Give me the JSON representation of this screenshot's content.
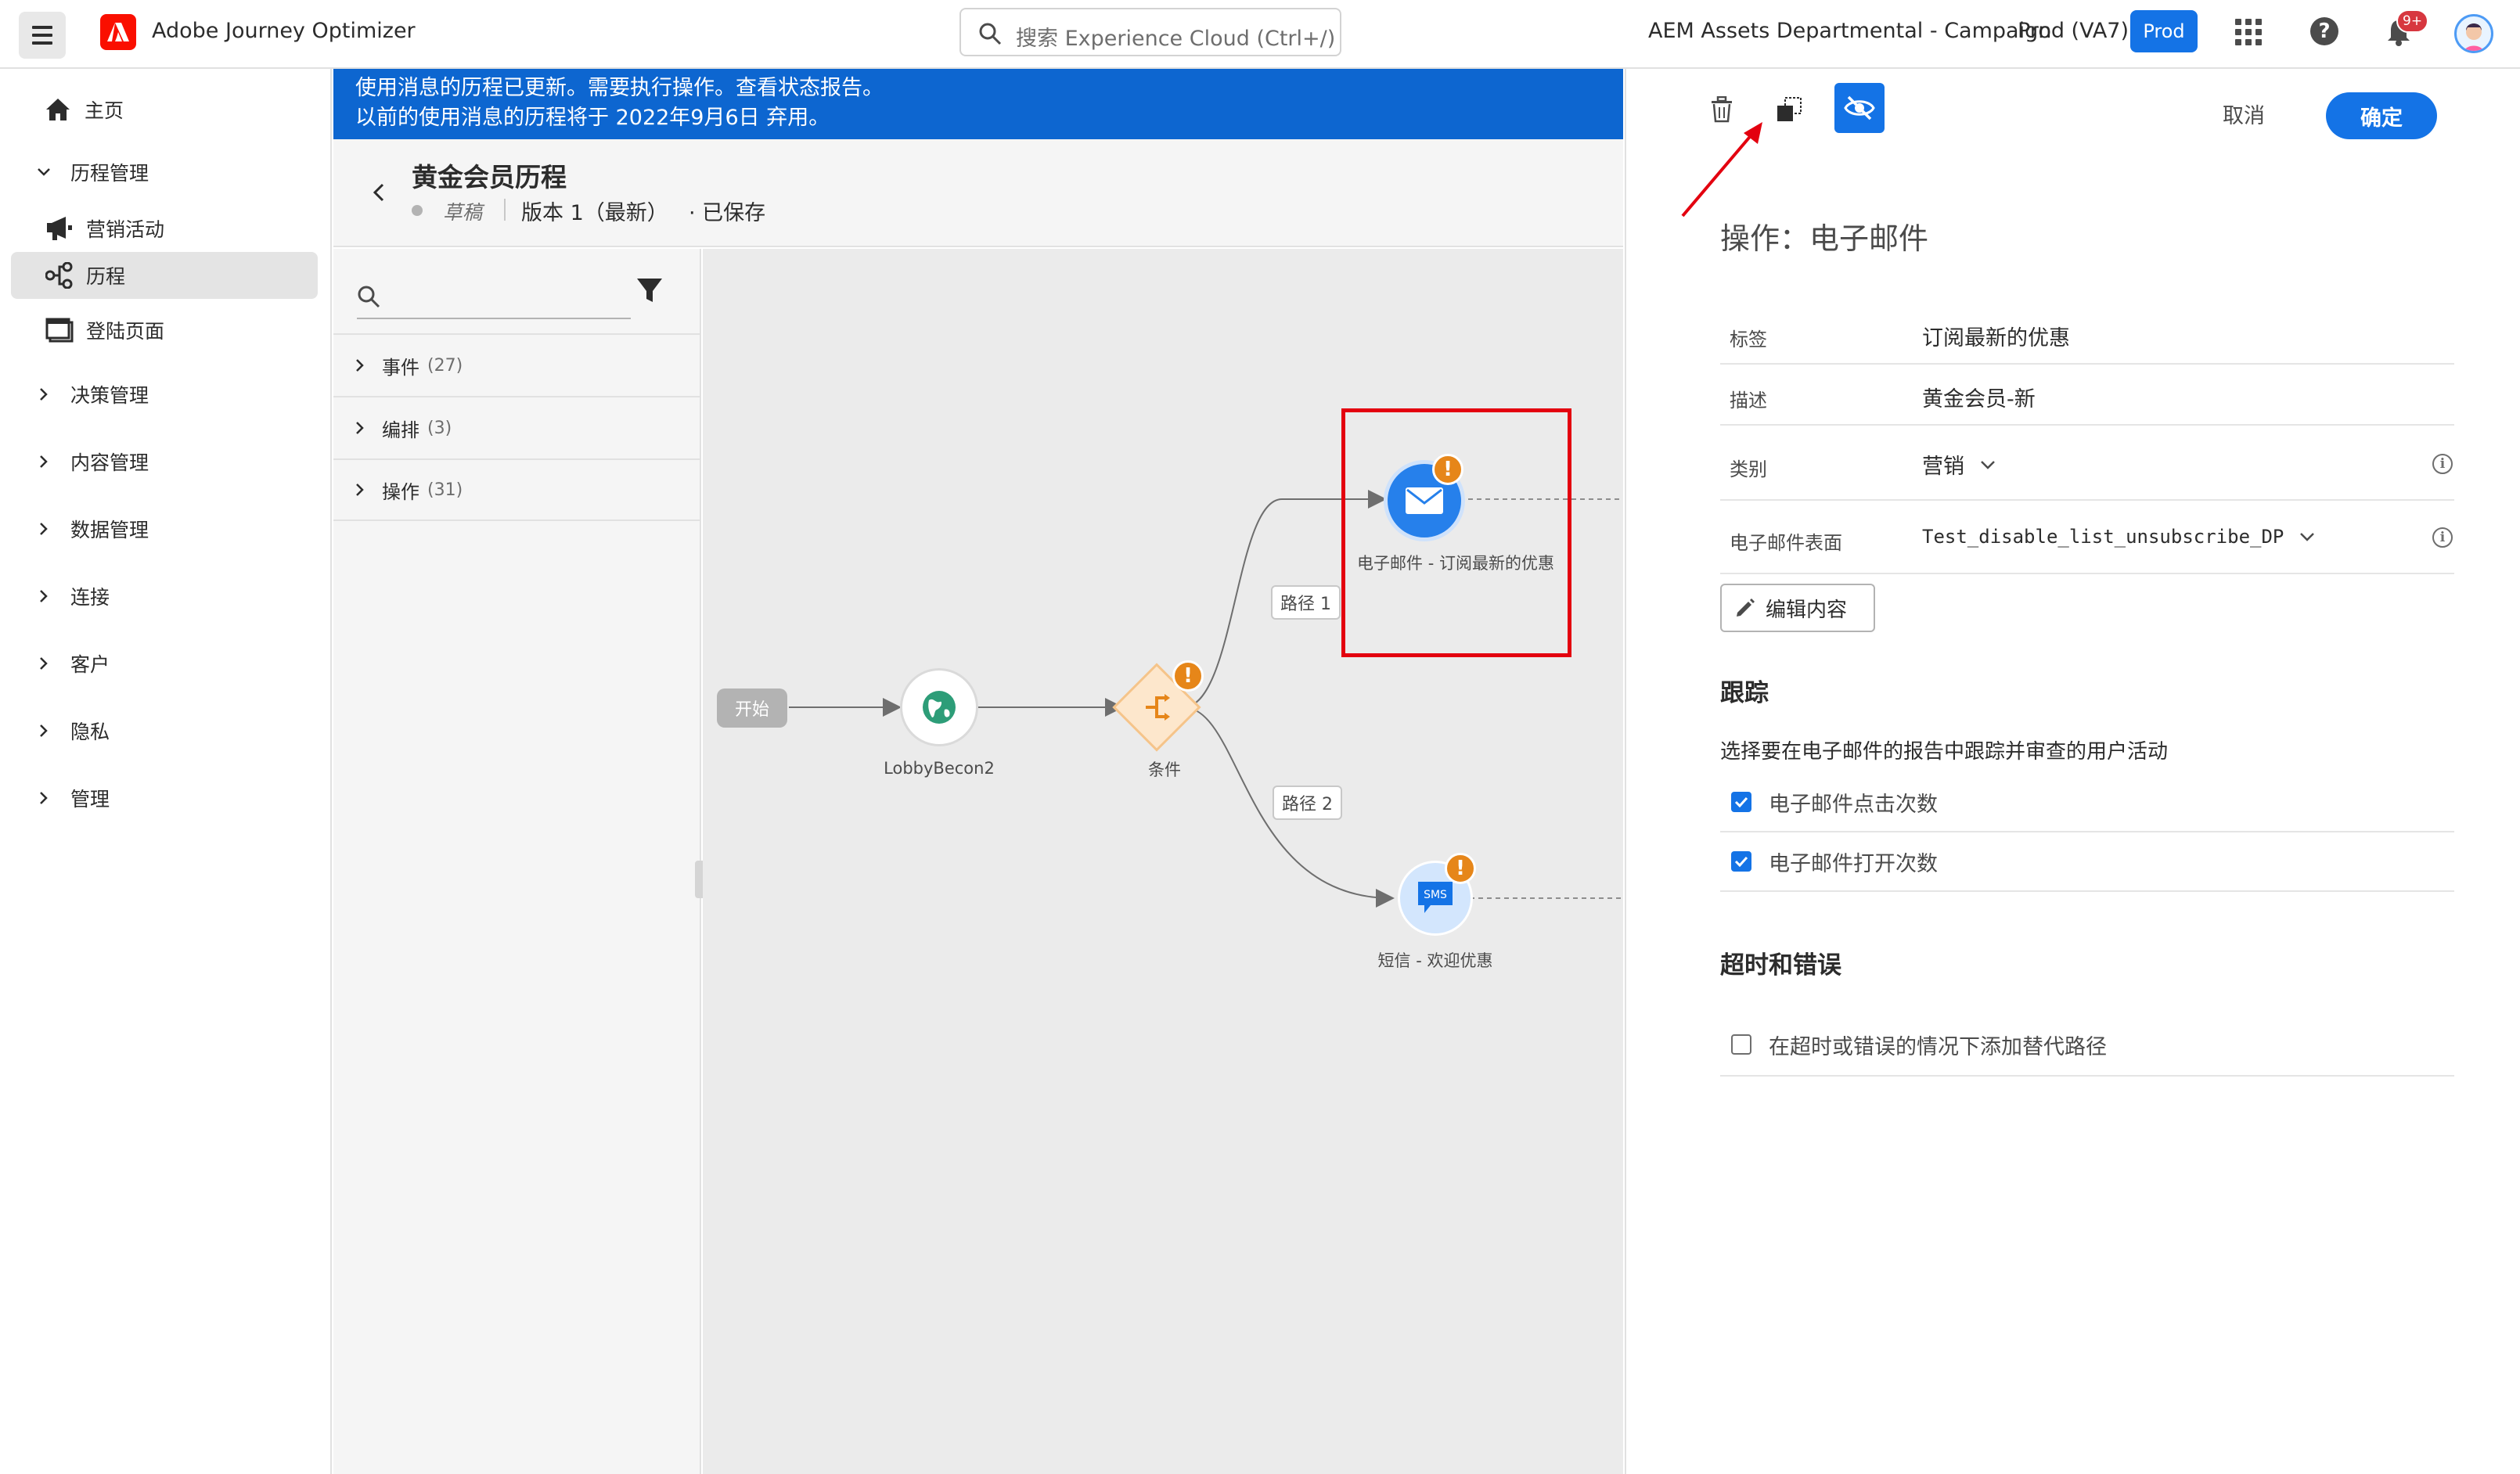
{
  "header": {
    "app_title": "Adobe Journey Optimizer",
    "search_placeholder": "搜索 Experience Cloud (Ctrl+/)",
    "org_name": "AEM Assets Departmental - Campaign",
    "sandbox_name": "Prod (VA7)",
    "env_badge": "Prod",
    "notification_count": "9+"
  },
  "nav": {
    "home": "主页",
    "journey_management": "历程管理",
    "campaigns": "营销活动",
    "journeys": "历程",
    "landing_pages": "登陆页面",
    "decision_management": "决策管理",
    "content_management": "内容管理",
    "data_management": "数据管理",
    "connections": "连接",
    "customers": "客户",
    "privacy": "隐私",
    "administration": "管理"
  },
  "banner": {
    "line1": "使用消息的历程已更新。需要执行操作。查看状态报告。",
    "line2": "以前的使用消息的历程将于 2022年9月6日 弃用。"
  },
  "journey": {
    "title": "黄金会员历程",
    "status": "草稿",
    "version": "版本 1（最新）",
    "saved": "· 已保存"
  },
  "palette": {
    "rows": [
      {
        "label": "事件",
        "count": "(27)"
      },
      {
        "label": "编排",
        "count": "(3)"
      },
      {
        "label": "操作",
        "count": "(31)"
      }
    ]
  },
  "canvas": {
    "start_label": "开始",
    "event_label": "LobbyBecon2",
    "condition_label": "条件",
    "path1_label": "路径 1",
    "path2_label": "路径 2",
    "email_label": "电子邮件 - 订阅最新的优惠",
    "sms_label": "短信 - 欢迎优惠",
    "sms_icon_text": "SMS"
  },
  "panel": {
    "cancel_label": "取消",
    "ok_label": "确定",
    "action_title": "操作：电子邮件",
    "fields": {
      "label_key": "标签",
      "label_value": "订阅最新的优惠",
      "description_key": "描述",
      "description_value": "黄金会员-新",
      "category_key": "类别",
      "category_value": "营销",
      "surface_key": "电子邮件表面",
      "surface_value": "Test_disable_list_unsubscribe_DP"
    },
    "edit_content_label": "编辑内容",
    "tracking_title": "跟踪",
    "tracking_desc": "选择要在电子邮件的报告中跟踪并审查的用户活动",
    "tracking_clicks": "电子邮件点击次数",
    "tracking_opens": "电子邮件打开次数",
    "timeout_title": "超时和错误",
    "timeout_option": "在超时或错误的情况下添加替代路径"
  },
  "colors": {
    "accent": "#1473e6",
    "banner": "#0d66d0",
    "warning": "#e68619",
    "highlight": "#e3000f"
  }
}
